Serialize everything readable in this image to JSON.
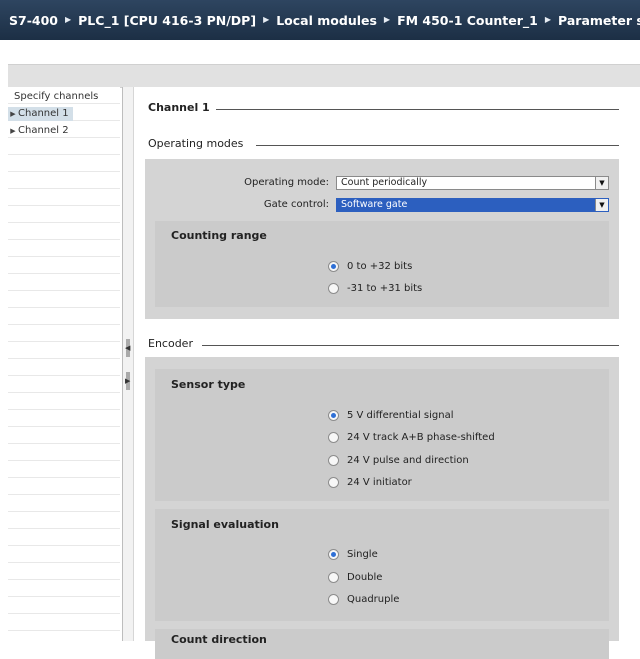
{
  "breadcrumb": [
    "S7-400",
    "PLC_1 [CPU 416-3 PN/DP]",
    "Local modules",
    "FM 450-1 Counter_1",
    "Parameter setting"
  ],
  "nav": {
    "items": [
      {
        "label": "Specify channels",
        "expandable": false,
        "selected": false
      },
      {
        "label": "Channel 1",
        "expandable": true,
        "selected": true
      },
      {
        "label": "Channel 2",
        "expandable": true,
        "selected": false
      }
    ]
  },
  "content": {
    "channel_title": "Channel 1",
    "operating_modes": {
      "title": "Operating modes",
      "operating_mode_label": "Operating mode:",
      "operating_mode_value": "Count periodically",
      "gate_control_label": "Gate control:",
      "gate_control_value": "Software gate",
      "counting_range": {
        "title": "Counting range",
        "options": [
          {
            "label": "0 to +32 bits",
            "selected": true
          },
          {
            "label": "-31 to +31 bits",
            "selected": false
          }
        ]
      }
    },
    "encoder": {
      "title": "Encoder",
      "sensor_type": {
        "title": "Sensor type",
        "options": [
          {
            "label": "5 V differential signal",
            "selected": true
          },
          {
            "label": "24 V track A+B phase-shifted",
            "selected": false
          },
          {
            "label": "24 V pulse and direction",
            "selected": false
          },
          {
            "label": "24 V initiator",
            "selected": false
          }
        ]
      },
      "signal_evaluation": {
        "title": "Signal evaluation",
        "options": [
          {
            "label": "Single",
            "selected": true
          },
          {
            "label": "Double",
            "selected": false
          },
          {
            "label": "Quadruple",
            "selected": false
          }
        ]
      },
      "count_direction": {
        "title": "Count direction"
      }
    }
  },
  "icons": {
    "breadcrumb_separator": "triangle-right-icon",
    "nav_expand": "triangle-right-icon",
    "dropdown": "chevron-down-icon"
  },
  "colors": {
    "title_bar": "#1f344c",
    "selected_field": "#2c5fbf",
    "radio_selected": "#2e6fd6",
    "panel": "#d4d4d4",
    "nav_selected": "#d3dfe8"
  }
}
